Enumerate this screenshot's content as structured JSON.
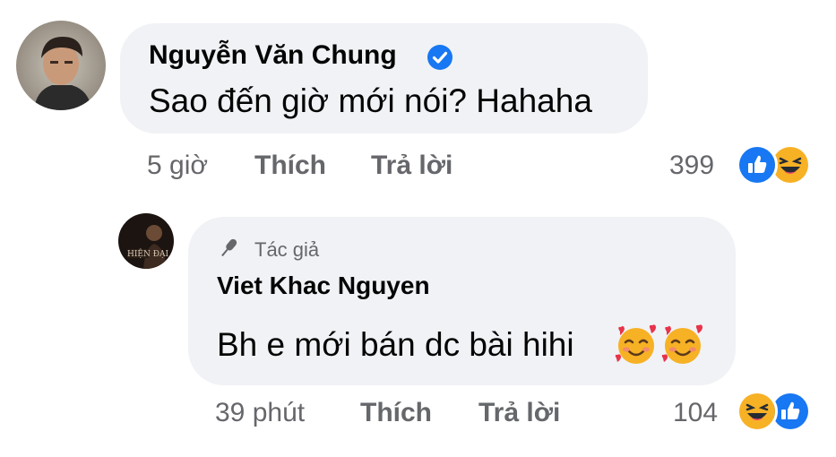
{
  "comments": [
    {
      "author": "Nguyễn Văn Chung",
      "verified": true,
      "text": "Sao đến giờ mới nói? Hahaha",
      "time": "5 giờ",
      "like_label": "Thích",
      "reply_label": "Trả lời",
      "reaction_count": "399",
      "reactions": [
        "like-icon",
        "haha-icon"
      ]
    },
    {
      "author_tag": "Tác giả",
      "author": "Viet Khac Nguyen",
      "text": "Bh e mới bán dc bài hihi",
      "emojis": [
        "smiling-face-with-hearts",
        "smiling-face-with-hearts"
      ],
      "time": "39 phút",
      "like_label": "Thích",
      "reply_label": "Trả lời",
      "reaction_count": "104",
      "reactions": [
        "haha-icon",
        "like-icon"
      ],
      "avatar_text": "HIỆN ĐẠI"
    }
  ],
  "colors": {
    "bubble": "#f0f2f5",
    "meta_text": "#65676b",
    "primary_text": "#050505",
    "like_blue": "#1877f2",
    "haha_yellow": "#f7b125"
  }
}
